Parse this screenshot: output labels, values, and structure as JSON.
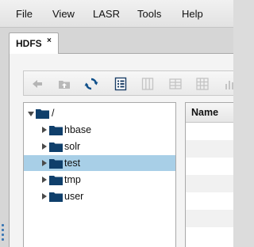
{
  "menubar": {
    "items": [
      {
        "label": "File"
      },
      {
        "label": "View"
      },
      {
        "label": "LASR"
      },
      {
        "label": "Tools"
      },
      {
        "label": "Help"
      }
    ]
  },
  "tab": {
    "label": "HDFS",
    "close_glyph": "×"
  },
  "toolbar": {
    "buttons": [
      {
        "icon": "back-arrow-icon",
        "enabled": false
      },
      {
        "icon": "folder-up-icon",
        "enabled": false
      },
      {
        "icon": "refresh-icon",
        "enabled": true
      },
      {
        "icon": "details-view-icon",
        "enabled": true
      },
      {
        "icon": "columns-view-icon",
        "enabled": false
      },
      {
        "icon": "table-view-icon",
        "enabled": false
      },
      {
        "icon": "grid-view-icon",
        "enabled": false
      },
      {
        "icon": "chart-icon",
        "enabled": false
      }
    ]
  },
  "tree": {
    "root": {
      "label": "/",
      "expanded": true
    },
    "children": [
      {
        "label": "hbase",
        "selected": false
      },
      {
        "label": "solr",
        "selected": false
      },
      {
        "label": "test",
        "selected": true
      },
      {
        "label": "tmp",
        "selected": false
      },
      {
        "label": "user",
        "selected": false
      }
    ]
  },
  "details": {
    "columns": [
      {
        "label": "Name"
      }
    ]
  },
  "colors": {
    "folder": "#0f3f6b",
    "selection": "#a8cfe7",
    "refresh_accent": "#0e4f8a"
  }
}
